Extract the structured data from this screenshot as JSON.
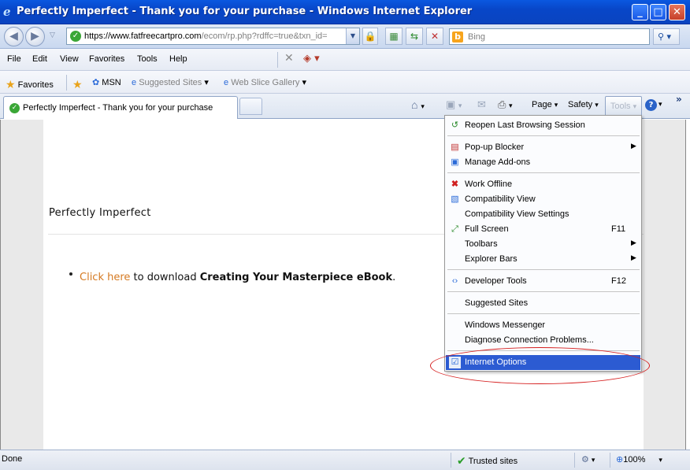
{
  "window": {
    "title": "Perfectly Imperfect - Thank you for your purchase - Windows Internet Explorer",
    "minimize": "_",
    "maximize": "□",
    "close": "✕"
  },
  "address": {
    "url_host": "https://www.fatfreecartpro.com",
    "url_rest": "/ecom/rp.php?rdffc=true&txn_id=",
    "search_placeholder": "Bing"
  },
  "menubar": [
    "File",
    "Edit",
    "View",
    "Favorites",
    "Tools",
    "Help"
  ],
  "favorites": {
    "label": "Favorites",
    "items": [
      "MSN",
      "Suggested Sites",
      "Web Slice Gallery"
    ]
  },
  "tab": {
    "label": "Perfectly Imperfect - Thank you for your purchase"
  },
  "commandbar": {
    "page": "Page",
    "safety": "Safety",
    "tools": "Tools"
  },
  "content": {
    "site_title": "Perfectly Imperfect",
    "link_text": "Click here",
    "middle_text": " to download ",
    "product": "Creating Your Masterpiece eBook",
    "period": "."
  },
  "tools_menu": {
    "items": [
      {
        "label": "Reopen Last Browsing Session",
        "icon": "reopen-icon"
      },
      {
        "label": "Pop-up Blocker",
        "icon": "popup-blocker-icon",
        "submenu": true
      },
      {
        "label": "Manage Add-ons",
        "icon": "addons-icon"
      },
      {
        "label": "Work Offline",
        "icon": "offline-icon"
      },
      {
        "label": "Compatibility View",
        "icon": "compat-icon"
      },
      {
        "label": "Compatibility View Settings"
      },
      {
        "label": "Full Screen",
        "icon": "fullscreen-icon",
        "shortcut": "F11"
      },
      {
        "label": "Toolbars",
        "submenu": true
      },
      {
        "label": "Explorer Bars",
        "submenu": true
      },
      {
        "label": "Developer Tools",
        "icon": "devtools-icon",
        "shortcut": "F12"
      },
      {
        "label": "Suggested Sites"
      },
      {
        "label": "Windows Messenger"
      },
      {
        "label": "Diagnose Connection Problems..."
      },
      {
        "label": "Internet Options",
        "icon": "options-icon",
        "highlighted": true
      }
    ]
  },
  "status": {
    "text": "Done",
    "zone": "Trusted sites",
    "zoom": "100%"
  }
}
